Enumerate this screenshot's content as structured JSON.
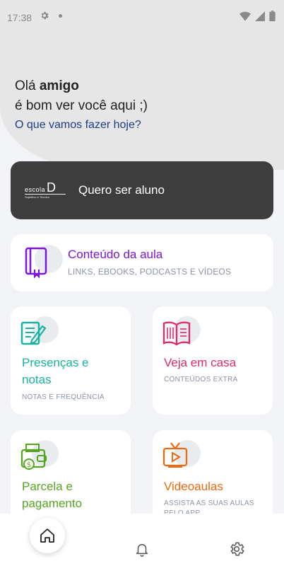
{
  "status_bar": {
    "time": "17:38"
  },
  "header": {
    "greeting_prefix": "Olá ",
    "greeting_name": "amigo",
    "greeting_line2": "é bom ver você aqui ;)",
    "question": "O que vamos fazer hoje?"
  },
  "student_button": {
    "logo_text": "escola",
    "logo_letter": "D",
    "logo_sub": "Supletivo e Técnico",
    "label": "Quero ser aluno"
  },
  "cards": {
    "content": {
      "title": "Conteúdo da aula",
      "subtitle": "LINKS, EBOOKS, PODCASTS E VÍDEOS",
      "color": "#7b16d6"
    },
    "presences": {
      "title": "Presenças e notas",
      "subtitle": "NOTAS E FREQUÊNCIA",
      "color": "#16b3a0"
    },
    "home": {
      "title": "Veja em casa",
      "subtitle": "CONTEÚDOS EXTRA",
      "color": "#e02a6a"
    },
    "installment": {
      "title": "Parcela e pagamento",
      "subtitle": "",
      "color": "#55a51f"
    },
    "video": {
      "title": "Videoaulas",
      "subtitle": "ASSISTA AS SUAS AULAS PELO APP",
      "color": "#ec6a12"
    }
  },
  "bottom_nav": {
    "items": [
      "home-icon",
      "bell-icon",
      "settings-icon"
    ]
  }
}
